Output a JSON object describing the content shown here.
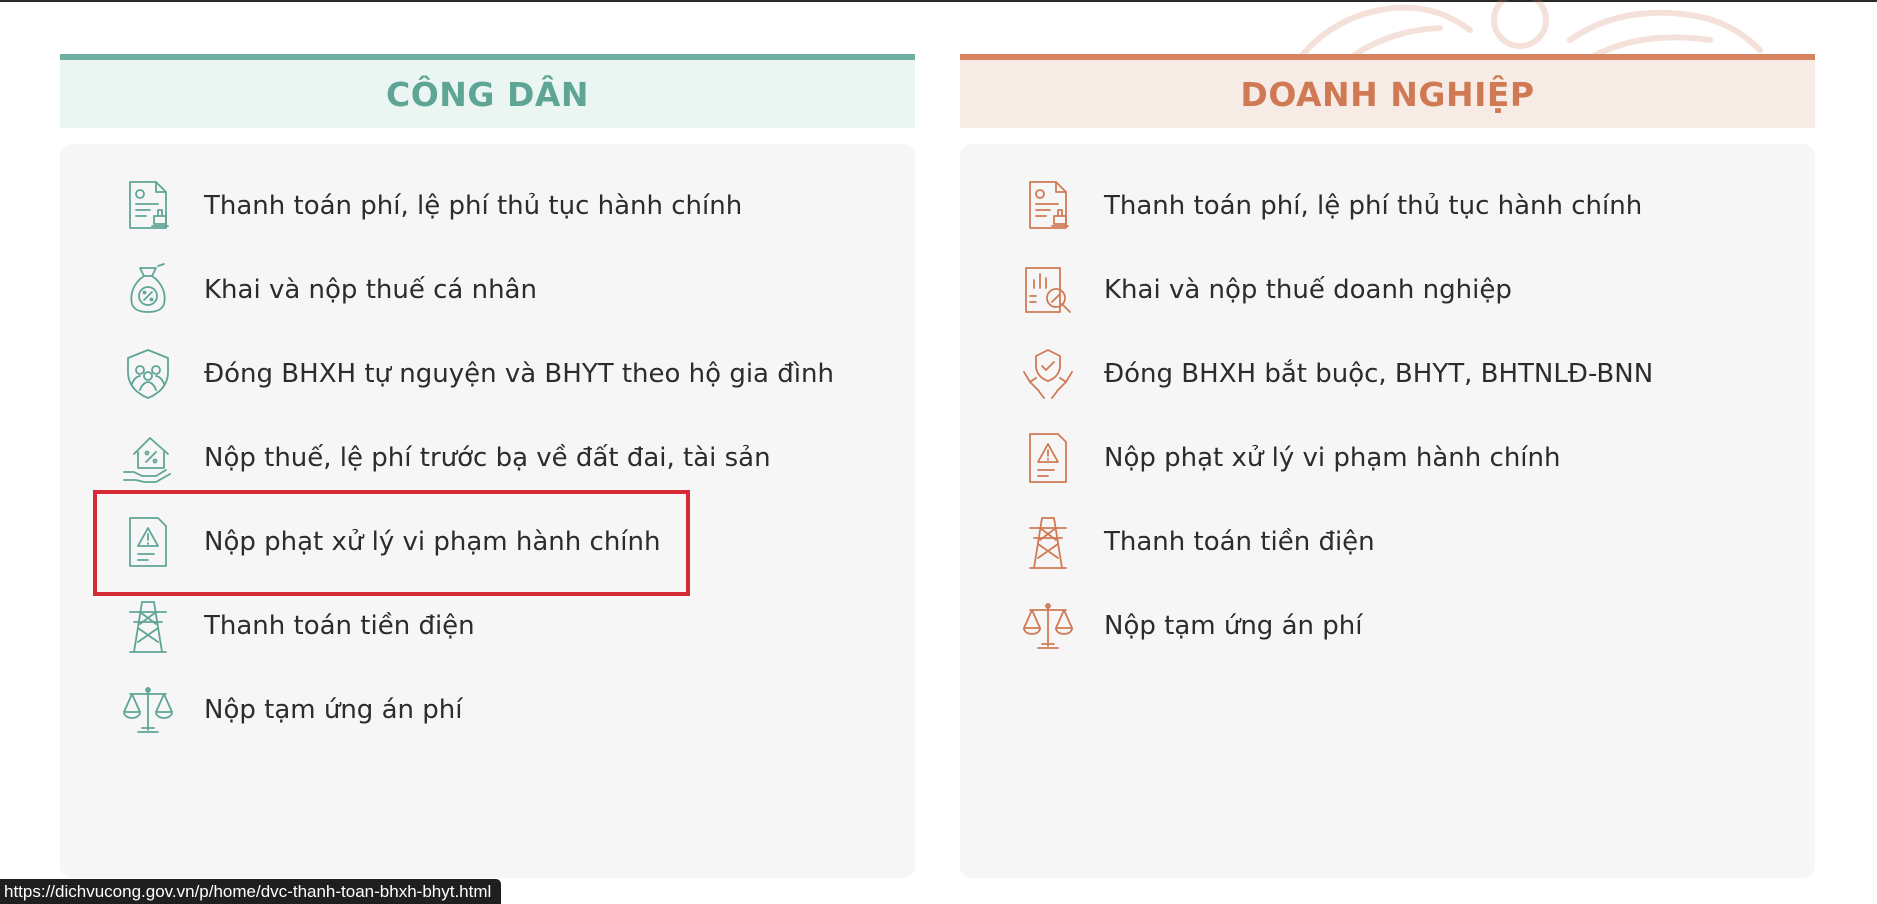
{
  "colors": {
    "citizen_accent": "#5fa596",
    "business_accent": "#d07a55",
    "highlight": "#d62a35"
  },
  "citizen": {
    "title": "CÔNG DÂN",
    "items": [
      {
        "label": "Thanh toán phí, lệ phí thủ tục hành chính",
        "icon": "document-seal-icon"
      },
      {
        "label": "Khai và nộp thuế cá nhân",
        "icon": "money-bag-percent-icon"
      },
      {
        "label": "Đóng BHXH tự nguyện và BHYT theo hộ gia đình",
        "icon": "family-shield-icon"
      },
      {
        "label": "Nộp thuế, lệ phí trước bạ về đất đai, tài sản",
        "icon": "house-hand-percent-icon"
      },
      {
        "label": "Nộp phạt xử lý vi phạm hành chính",
        "icon": "warning-document-icon"
      },
      {
        "label": "Thanh toán tiền điện",
        "icon": "power-tower-icon"
      },
      {
        "label": "Nộp tạm ứng án phí",
        "icon": "scales-icon"
      }
    ]
  },
  "business": {
    "title": "DOANH NGHIỆP",
    "items": [
      {
        "label": "Thanh toán phí, lệ phí thủ tục hành chính",
        "icon": "document-seal-icon"
      },
      {
        "label": "Khai và nộp thuế doanh nghiệp",
        "icon": "chart-report-percent-icon"
      },
      {
        "label": "Đóng BHXH bắt buộc, BHYT, BHTNLĐ-BNN",
        "icon": "hands-shield-check-icon"
      },
      {
        "label": "Nộp phạt xử lý vi phạm hành chính",
        "icon": "warning-document-icon"
      },
      {
        "label": "Thanh toán tiền điện",
        "icon": "power-tower-icon"
      },
      {
        "label": "Nộp tạm ứng án phí",
        "icon": "scales-icon"
      }
    ]
  },
  "status_bar": {
    "url": "https://dichvucong.gov.vn/p/home/dvc-thanh-toan-bhxh-bhyt.html"
  }
}
